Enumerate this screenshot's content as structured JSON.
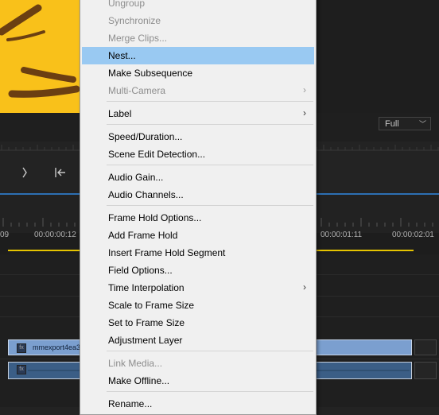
{
  "monitor": {
    "quality_select": "Full"
  },
  "transport": {
    "icons": [
      "mark-out-icon",
      "go-to-in-icon"
    ]
  },
  "timeline": {
    "timecodes": [
      "09",
      "00:00:00:12",
      "00:00:01:11",
      "00:00:02:01"
    ],
    "video_clip_label": "mmexport4ea3",
    "fx_badge": "fx"
  },
  "context_menu": {
    "items": [
      {
        "label": "Ungroup",
        "enabled": false
      },
      {
        "label": "Synchronize",
        "enabled": false
      },
      {
        "label": "Merge Clips...",
        "enabled": false
      },
      {
        "label": "Nest...",
        "enabled": true,
        "highlighted": true
      },
      {
        "label": "Make Subsequence",
        "enabled": true
      },
      {
        "label": "Multi-Camera",
        "enabled": false,
        "submenu": true
      },
      {
        "label": "Label",
        "enabled": true,
        "submenu": true
      },
      {
        "label": "Speed/Duration...",
        "enabled": true
      },
      {
        "label": "Scene Edit Detection...",
        "enabled": true
      },
      {
        "label": "Audio Gain...",
        "enabled": true
      },
      {
        "label": "Audio Channels...",
        "enabled": true
      },
      {
        "label": "Frame Hold Options...",
        "enabled": true
      },
      {
        "label": "Add Frame Hold",
        "enabled": true
      },
      {
        "label": "Insert Frame Hold Segment",
        "enabled": true
      },
      {
        "label": "Field Options...",
        "enabled": true
      },
      {
        "label": "Time Interpolation",
        "enabled": true,
        "submenu": true
      },
      {
        "label": "Scale to Frame Size",
        "enabled": true
      },
      {
        "label": "Set to Frame Size",
        "enabled": true
      },
      {
        "label": "Adjustment Layer",
        "enabled": true
      },
      {
        "label": "Link Media...",
        "enabled": false
      },
      {
        "label": "Make Offline...",
        "enabled": true
      },
      {
        "label": "Rename...",
        "enabled": true
      }
    ],
    "submenu_arrow": "›"
  },
  "colors": {
    "highlight": "#99c9f2",
    "playhead_bar": "#e5c300",
    "video_clip": "#7b9fcf",
    "audio_clip": "#3b5e86"
  }
}
